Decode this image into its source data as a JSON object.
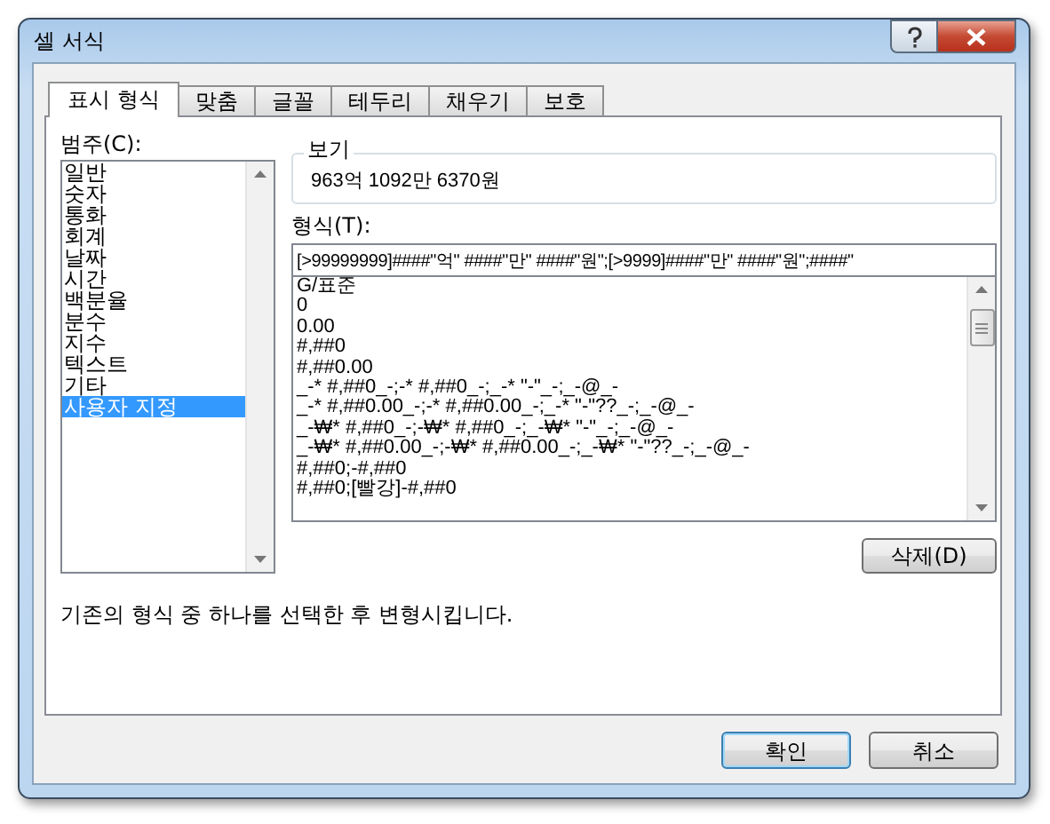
{
  "window": {
    "title": "셀 서식"
  },
  "tabs": [
    {
      "label": "표시 형식",
      "selected": true
    },
    {
      "label": "맞춤",
      "selected": false
    },
    {
      "label": "글꼴",
      "selected": false
    },
    {
      "label": "테두리",
      "selected": false
    },
    {
      "label": "채우기",
      "selected": false
    },
    {
      "label": "보호",
      "selected": false
    }
  ],
  "category": {
    "label": "범주(C):",
    "items": [
      {
        "label": "일반",
        "selected": false
      },
      {
        "label": "숫자",
        "selected": false
      },
      {
        "label": "통화",
        "selected": false
      },
      {
        "label": "회계",
        "selected": false
      },
      {
        "label": "날짜",
        "selected": false
      },
      {
        "label": "시간",
        "selected": false
      },
      {
        "label": "백분율",
        "selected": false
      },
      {
        "label": "분수",
        "selected": false
      },
      {
        "label": "지수",
        "selected": false
      },
      {
        "label": "텍스트",
        "selected": false
      },
      {
        "label": "기타",
        "selected": false
      },
      {
        "label": "사용자 지정",
        "selected": true
      }
    ]
  },
  "sample": {
    "label": "보기",
    "value": "963억 1092만 6370원"
  },
  "format": {
    "label": "형식(T):",
    "value": "[>99999999]####\"억\" ####\"만\" ####\"원\";[>9999]####\"만\" ####\"원\";####\"",
    "items": [
      "G/표준",
      "0",
      "0.00",
      "#,##0",
      "#,##0.00",
      "_-* #,##0_-;-* #,##0_-;_-* \"-\"_-;_-@_-",
      "_-* #,##0.00_-;-* #,##0.00_-;_-* \"-\"??_-;_-@_-",
      "_-₩* #,##0_-;-₩* #,##0_-;_-₩* \"-\"_-;_-@_-",
      "_-₩* #,##0.00_-;-₩* #,##0.00_-;_-₩* \"-\"??_-;_-@_-",
      "#,##0;-#,##0",
      "#,##0;[빨강]-#,##0"
    ]
  },
  "delete_button": "삭제(D)",
  "description": "기존의 형식 중 하나를 선택한 후 변형시킵니다.",
  "buttons": [
    "확인",
    "취소"
  ]
}
